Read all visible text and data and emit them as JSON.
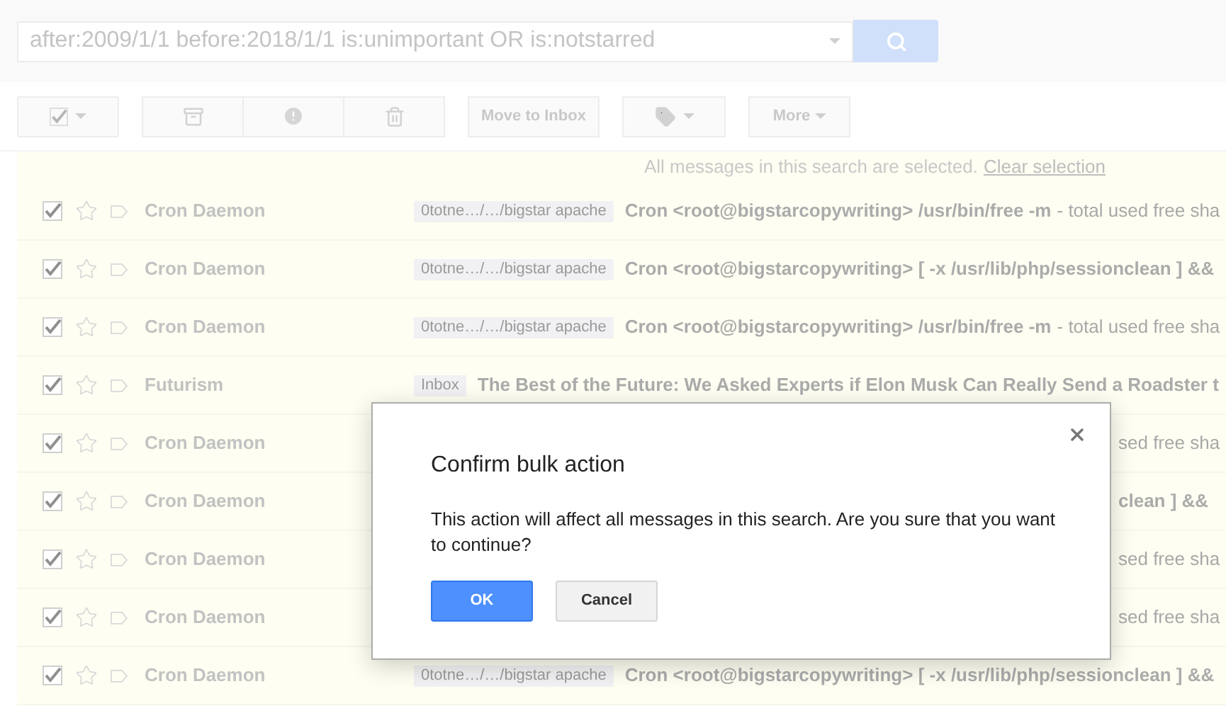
{
  "search": {
    "value": "after:2009/1/1 before:2018/1/1 is:unimportant OR is:notstarred"
  },
  "toolbar": {
    "select_all": {
      "checked": true
    },
    "move_button": "Move to Inbox",
    "more_button": "More"
  },
  "notice": {
    "text": "All messages in this search are selected.",
    "link": "Clear selection"
  },
  "rows": [
    {
      "kind": "full",
      "checked": true,
      "starred": false,
      "sender": "Cron Daemon",
      "label": "0totne…/…/bigstar apache",
      "subject": "Cron <root@bigstarcopywriting> /usr/bin/free -m",
      "snippet": "- total used free sha"
    },
    {
      "kind": "full",
      "checked": true,
      "starred": false,
      "sender": "Cron Daemon",
      "label": "0totne…/…/bigstar apache",
      "subject": "Cron <root@bigstarcopywriting> [ -x /usr/lib/php/sessionclean ] &&"
    },
    {
      "kind": "full",
      "checked": true,
      "starred": false,
      "sender": "Cron Daemon",
      "label": "0totne…/…/bigstar apache",
      "subject": "Cron <root@bigstarcopywriting> /usr/bin/free -m",
      "snippet": "- total used free sha"
    },
    {
      "kind": "full",
      "checked": true,
      "starred": false,
      "sender": "Futurism",
      "label": "Inbox",
      "subject": "The Best of the Future: We Asked Experts if Elon Musk Can Really Send a Roadster t"
    },
    {
      "kind": "covered",
      "checked": true,
      "starred": false,
      "sender": "Cron Daemon",
      "snippet": "sed free sha"
    },
    {
      "kind": "covered",
      "checked": true,
      "starred": false,
      "sender": "Cron Daemon",
      "subject": "clean ] &&"
    },
    {
      "kind": "covered",
      "checked": true,
      "starred": false,
      "sender": "Cron Daemon",
      "snippet": "sed free sha"
    },
    {
      "kind": "covered",
      "checked": true,
      "starred": false,
      "sender": "Cron Daemon",
      "snippet": "sed free sha"
    },
    {
      "kind": "full",
      "checked": true,
      "starred": false,
      "sender": "Cron Daemon",
      "label": "0totne…/…/bigstar apache",
      "subject": "Cron <root@bigstarcopywriting> [ -x /usr/lib/php/sessionclean ] &&"
    }
  ],
  "dialog": {
    "title": "Confirm bulk action",
    "body": "This action will affect all messages in this search. Are you sure that you want to continue?",
    "ok": "OK",
    "cancel": "Cancel"
  }
}
